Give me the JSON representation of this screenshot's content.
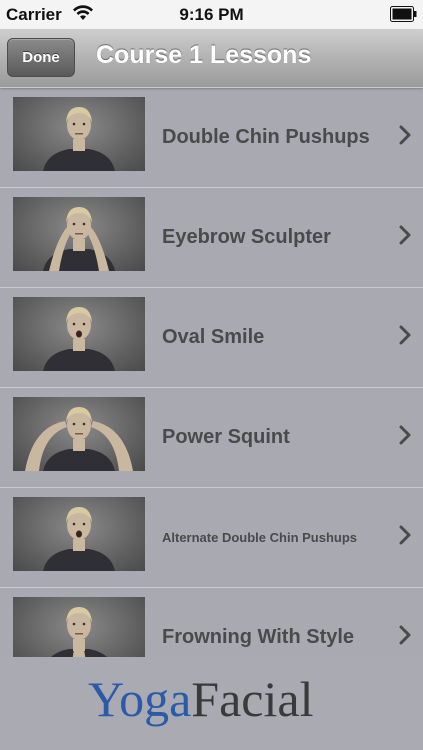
{
  "status_bar": {
    "carrier": "Carrier",
    "time": "9:16 PM"
  },
  "nav": {
    "done_label": "Done",
    "title": "Course 1 Lessons"
  },
  "lessons": [
    {
      "title": "Double Chin Pushups",
      "pose": "neutral"
    },
    {
      "title": "Eyebrow Sculpter",
      "pose": "hands-forehead"
    },
    {
      "title": "Oval Smile",
      "pose": "mouth-open"
    },
    {
      "title": "Power Squint",
      "pose": "hands-eyes"
    },
    {
      "title": "Alternate Double Chin Pushups",
      "pose": "mouth-open",
      "small": true
    },
    {
      "title": "Frowning With Style",
      "pose": "hands-chin"
    }
  ],
  "logo": {
    "part1": "Yoga",
    "part2": "Facial"
  },
  "colors": {
    "nav_gradient_top": "#cfcfcf",
    "list_bg": "#a9a9b2",
    "logo_blue": "#2a5aa8"
  }
}
